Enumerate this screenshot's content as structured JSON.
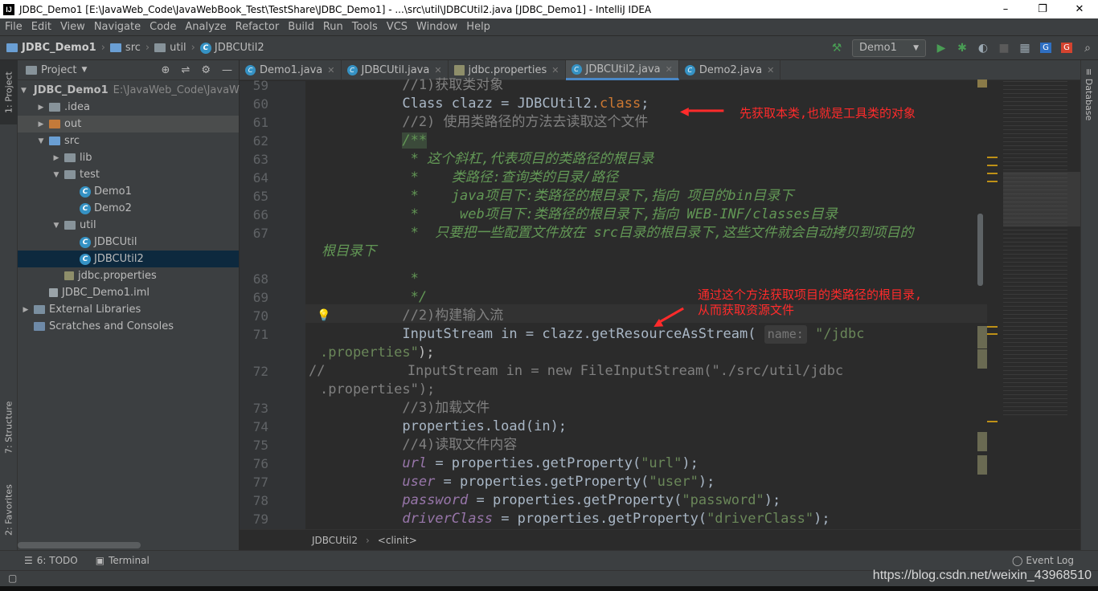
{
  "window": {
    "title": "JDBC_Demo1 [E:\\JavaWeb_Code\\JavaWebBook_Test\\TestShare\\JDBC_Demo1] - ...\\src\\util\\JDBCUtil2.java [JDBC_Demo1] - IntelliJ IDEA",
    "app_icon": "IJ",
    "minimize": "–",
    "maximize": "❐",
    "close": "✕"
  },
  "menu": [
    "File",
    "Edit",
    "View",
    "Navigate",
    "Code",
    "Analyze",
    "Refactor",
    "Build",
    "Run",
    "Tools",
    "VCS",
    "Window",
    "Help"
  ],
  "breadcrumb": {
    "project": "JDBC_Demo1",
    "src": "src",
    "util": "util",
    "file": "JDBCUtil2"
  },
  "toolbar": {
    "run_config": "Demo1"
  },
  "left_tabs": {
    "project": "1: Project",
    "structure": "7: Structure",
    "favorites": "2: Favorites"
  },
  "right_tabs": {
    "database": "Database"
  },
  "project_panel": {
    "title": "Project",
    "tree": [
      {
        "label": "JDBC_Demo1",
        "extra": "E:\\JavaWeb_Code\\JavaWe",
        "indent": 0,
        "arrow": "▼",
        "icon": "folder-blue",
        "bold": true
      },
      {
        "label": ".idea",
        "indent": 1,
        "arrow": "▶",
        "icon": "folder"
      },
      {
        "label": "out",
        "indent": 1,
        "arrow": "▶",
        "icon": "folder-orange",
        "hover": true
      },
      {
        "label": "src",
        "indent": 1,
        "arrow": "▼",
        "icon": "folder-blue"
      },
      {
        "label": "lib",
        "indent": 2,
        "arrow": "▶",
        "icon": "folder"
      },
      {
        "label": "test",
        "indent": 2,
        "arrow": "▼",
        "icon": "folder"
      },
      {
        "label": "Demo1",
        "indent": 3,
        "arrow": "",
        "icon": "class"
      },
      {
        "label": "Demo2",
        "indent": 3,
        "arrow": "",
        "icon": "class"
      },
      {
        "label": "util",
        "indent": 2,
        "arrow": "▼",
        "icon": "folder"
      },
      {
        "label": "JDBCUtil",
        "indent": 3,
        "arrow": "",
        "icon": "class"
      },
      {
        "label": "JDBCUtil2",
        "indent": 3,
        "arrow": "",
        "icon": "class",
        "selected": true
      },
      {
        "label": "jdbc.properties",
        "indent": 2,
        "arrow": "",
        "icon": "props"
      },
      {
        "label": "JDBC_Demo1.iml",
        "indent": 1,
        "arrow": "",
        "icon": "file"
      },
      {
        "label": "External Libraries",
        "indent": 0,
        "arrow": "▶",
        "icon": "libs"
      },
      {
        "label": "Scratches and Consoles",
        "indent": 0,
        "arrow": "",
        "icon": "scratch"
      }
    ]
  },
  "tabs": [
    {
      "label": "Demo1.java",
      "icon": "class"
    },
    {
      "label": "JDBCUtil.java",
      "icon": "class"
    },
    {
      "label": "jdbc.properties",
      "icon": "props"
    },
    {
      "label": "JDBCUtil2.java",
      "icon": "class",
      "active": true
    },
    {
      "label": "Demo2.java",
      "icon": "class"
    }
  ],
  "annotations": {
    "a1": "先获取本类,也就是工具类的对象",
    "a2_line1": "通过这个方法获取项目的类路径的根目录,",
    "a2_line2": "从而获取资源文件"
  },
  "editor_breadcrumb": {
    "cls": "JDBCUtil2",
    "method": "<clinit>"
  },
  "bottom": {
    "todo": "6: TODO",
    "terminal": "Terminal",
    "event_log": "Event Log"
  },
  "watermark": "https://blog.csdn.net/weixin_43968510"
}
